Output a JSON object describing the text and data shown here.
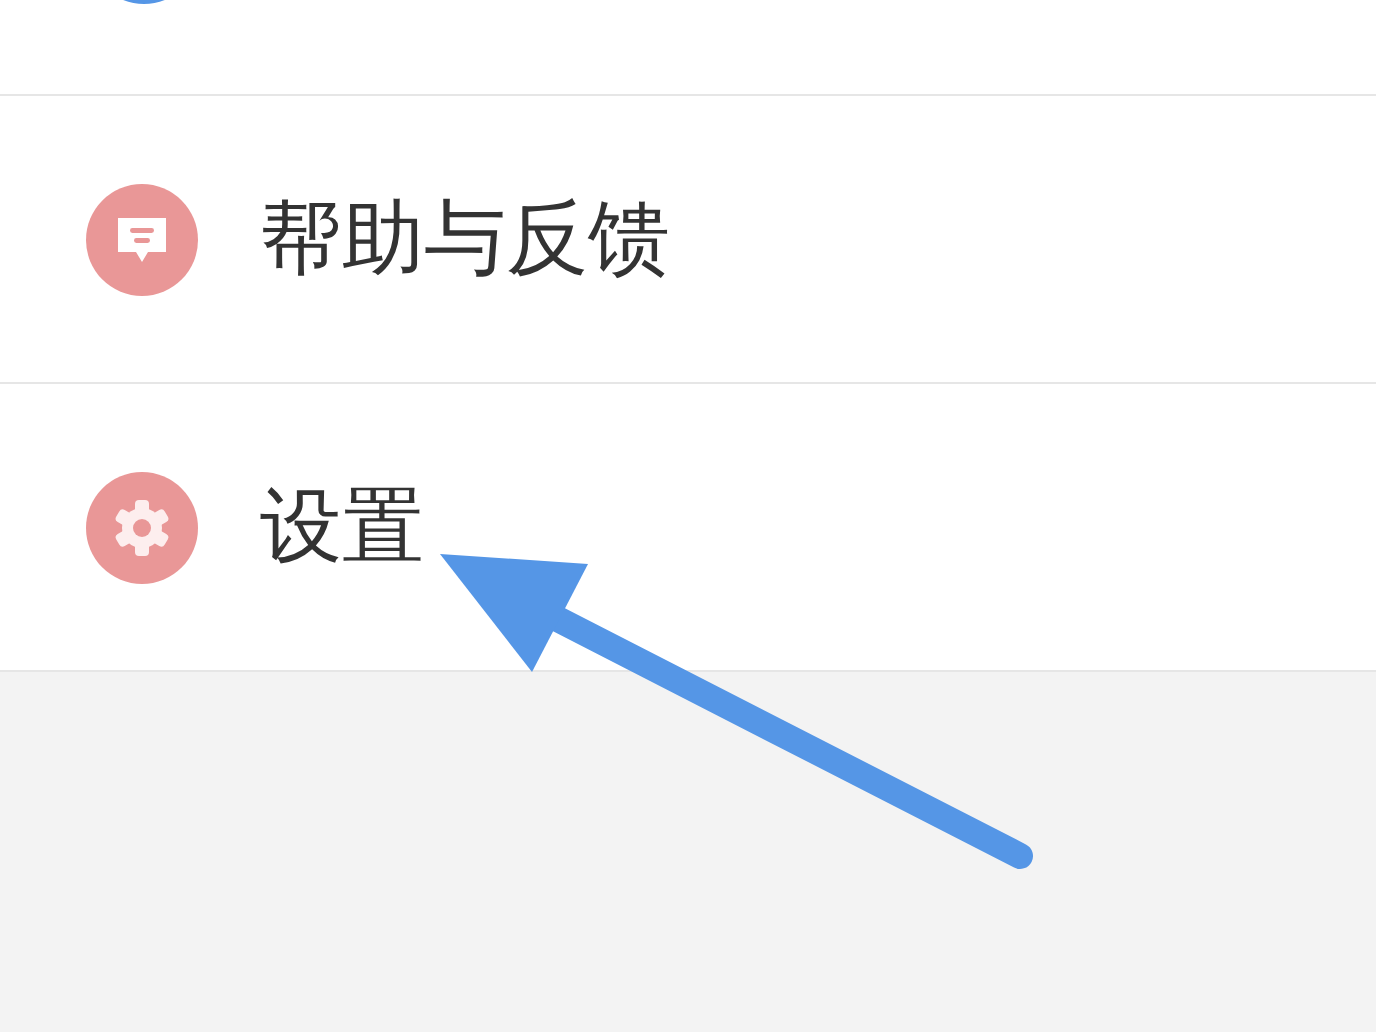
{
  "menu_items": [
    {
      "label": "帮助与反馈",
      "kind": "help"
    },
    {
      "label": "设置",
      "kind": "settings"
    }
  ]
}
